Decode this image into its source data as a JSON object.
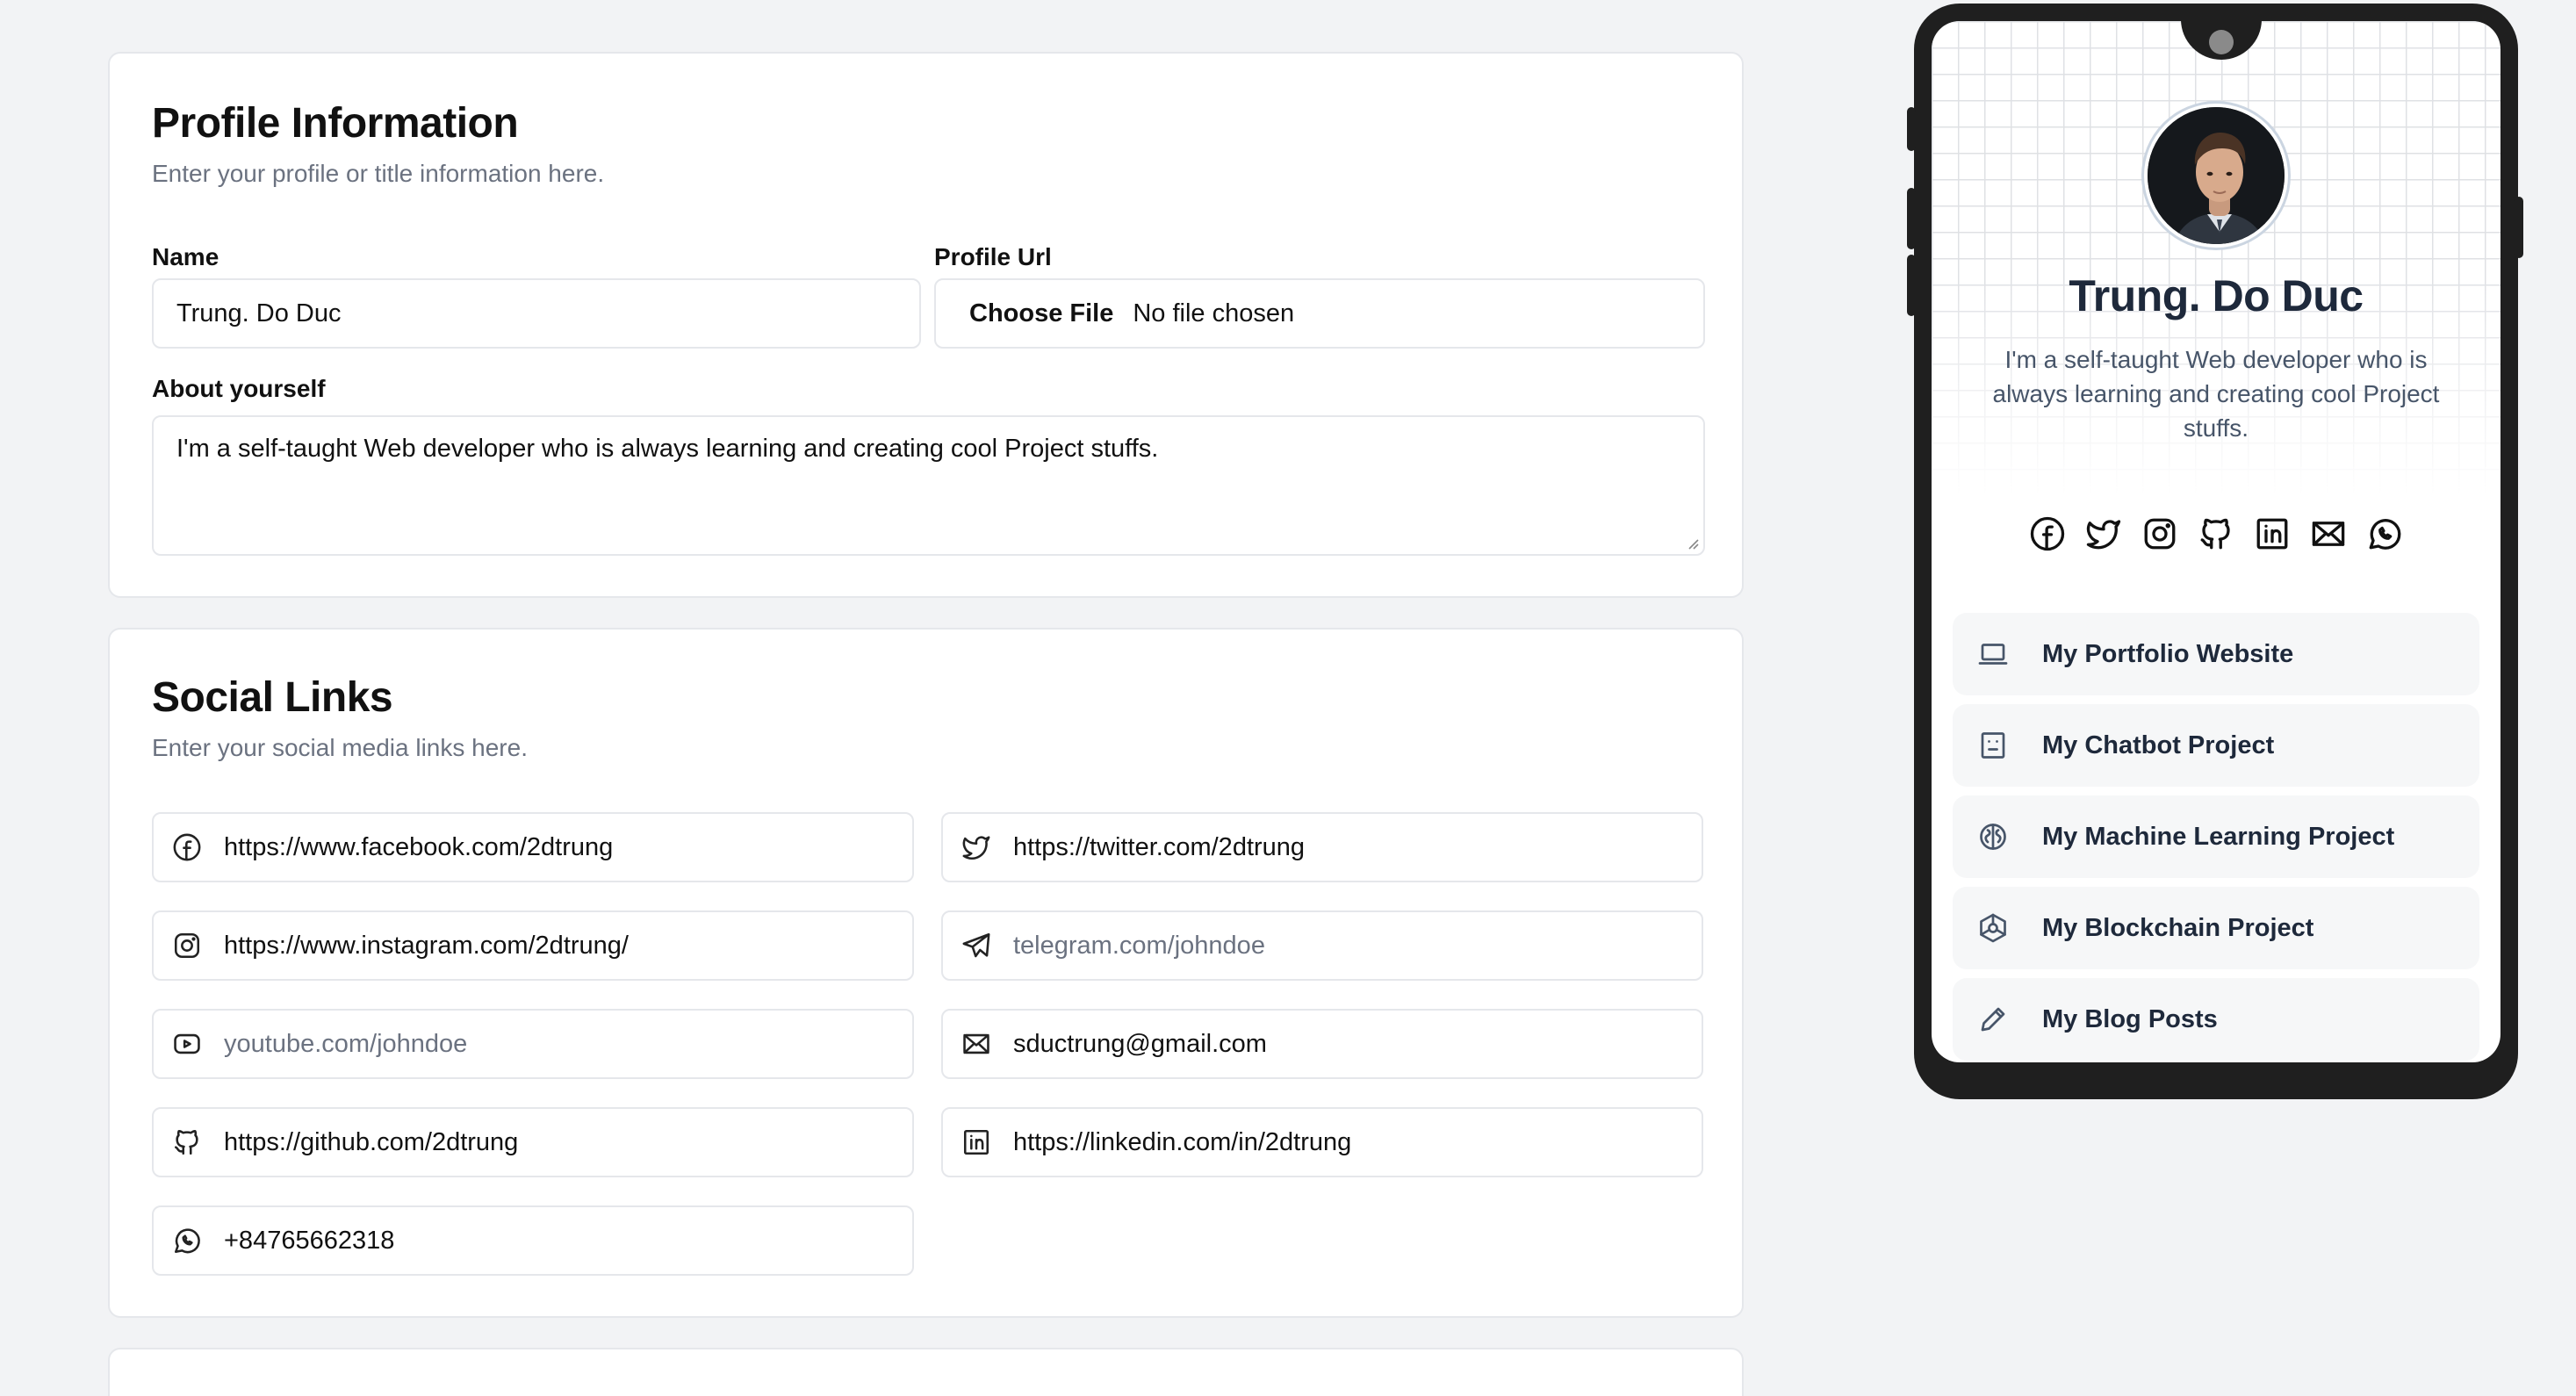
{
  "profile": {
    "title": "Profile Information",
    "subtitle": "Enter your profile or title information here.",
    "name_label": "Name",
    "name_value": "Trung. Do Duc",
    "url_label": "Profile Url",
    "file_button": "Choose File",
    "file_status": "No file chosen",
    "about_label": "About yourself",
    "about_value": "I'm a self-taught Web developer who is always learning and creating cool Project stuffs."
  },
  "social": {
    "title": "Social Links",
    "subtitle": "Enter your social media links here.",
    "links": [
      {
        "icon": "facebook-icon",
        "value": "https://www.facebook.com/2dtrung",
        "placeholder": false
      },
      {
        "icon": "twitter-icon",
        "value": "https://twitter.com/2dtrung",
        "placeholder": false
      },
      {
        "icon": "instagram-icon",
        "value": "https://www.instagram.com/2dtrung/",
        "placeholder": false
      },
      {
        "icon": "telegram-icon",
        "value": "telegram.com/johndoe",
        "placeholder": true
      },
      {
        "icon": "youtube-icon",
        "value": "youtube.com/johndoe",
        "placeholder": true
      },
      {
        "icon": "email-icon",
        "value": "sductrung@gmail.com",
        "placeholder": false
      },
      {
        "icon": "github-icon",
        "value": "https://github.com/2dtrung",
        "placeholder": false
      },
      {
        "icon": "linkedin-icon",
        "value": "https://linkedin.com/in/2dtrung",
        "placeholder": false
      },
      {
        "icon": "whatsapp-icon",
        "value": "+84765662318",
        "placeholder": false
      }
    ]
  },
  "preview": {
    "name": "Trung. Do Duc",
    "bio": "I'm a self-taught Web developer who is always learning and creating cool Project stuffs.",
    "social_icons": [
      "facebook-icon",
      "twitter-icon",
      "instagram-icon",
      "github-icon",
      "linkedin-icon",
      "email-icon",
      "whatsapp-icon"
    ],
    "links": [
      {
        "icon": "laptop-icon",
        "label": "My Portfolio Website"
      },
      {
        "icon": "bot-icon",
        "label": "My Chatbot Project"
      },
      {
        "icon": "brain-icon",
        "label": "My Machine Learning Project"
      },
      {
        "icon": "blockchain-icon",
        "label": "My Blockchain Project"
      },
      {
        "icon": "pencil-icon",
        "label": "My Blog Posts"
      }
    ]
  }
}
